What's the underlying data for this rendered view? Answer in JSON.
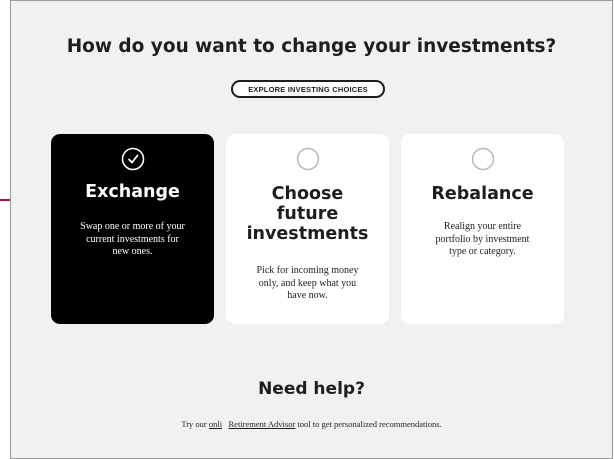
{
  "heading": "How do you want to change your investments?",
  "explore_button": "EXPLORE INVESTING CHOICES",
  "cards": [
    {
      "title_lines": [
        "Exchange"
      ],
      "desc_lines": [
        "Swap one or more of your",
        "current investments for",
        "new ones."
      ],
      "selected": true,
      "icon": "checked-radio-icon"
    },
    {
      "title_lines": [
        "Choose",
        "future",
        "investments"
      ],
      "desc_lines": [
        "Pick for incoming money",
        "only, and keep what you",
        "have now."
      ],
      "selected": false,
      "icon": "empty-radio-icon"
    },
    {
      "title_lines": [
        "Rebalance"
      ],
      "desc_lines": [
        "Realign your entire",
        "portfolio by investment",
        "type or category."
      ],
      "selected": false,
      "icon": "empty-radio-icon"
    }
  ],
  "help": {
    "title": "Need help?",
    "text_before": "Try our ",
    "link_1": "onli",
    "link_2": "Retirement Advisor",
    "text_after": " tool to get personalized recommendations."
  },
  "colors": {
    "arrow": "#b0122f",
    "selected_card": "#000000",
    "card": "#ffffff",
    "page_background": "#f1f1f1"
  }
}
